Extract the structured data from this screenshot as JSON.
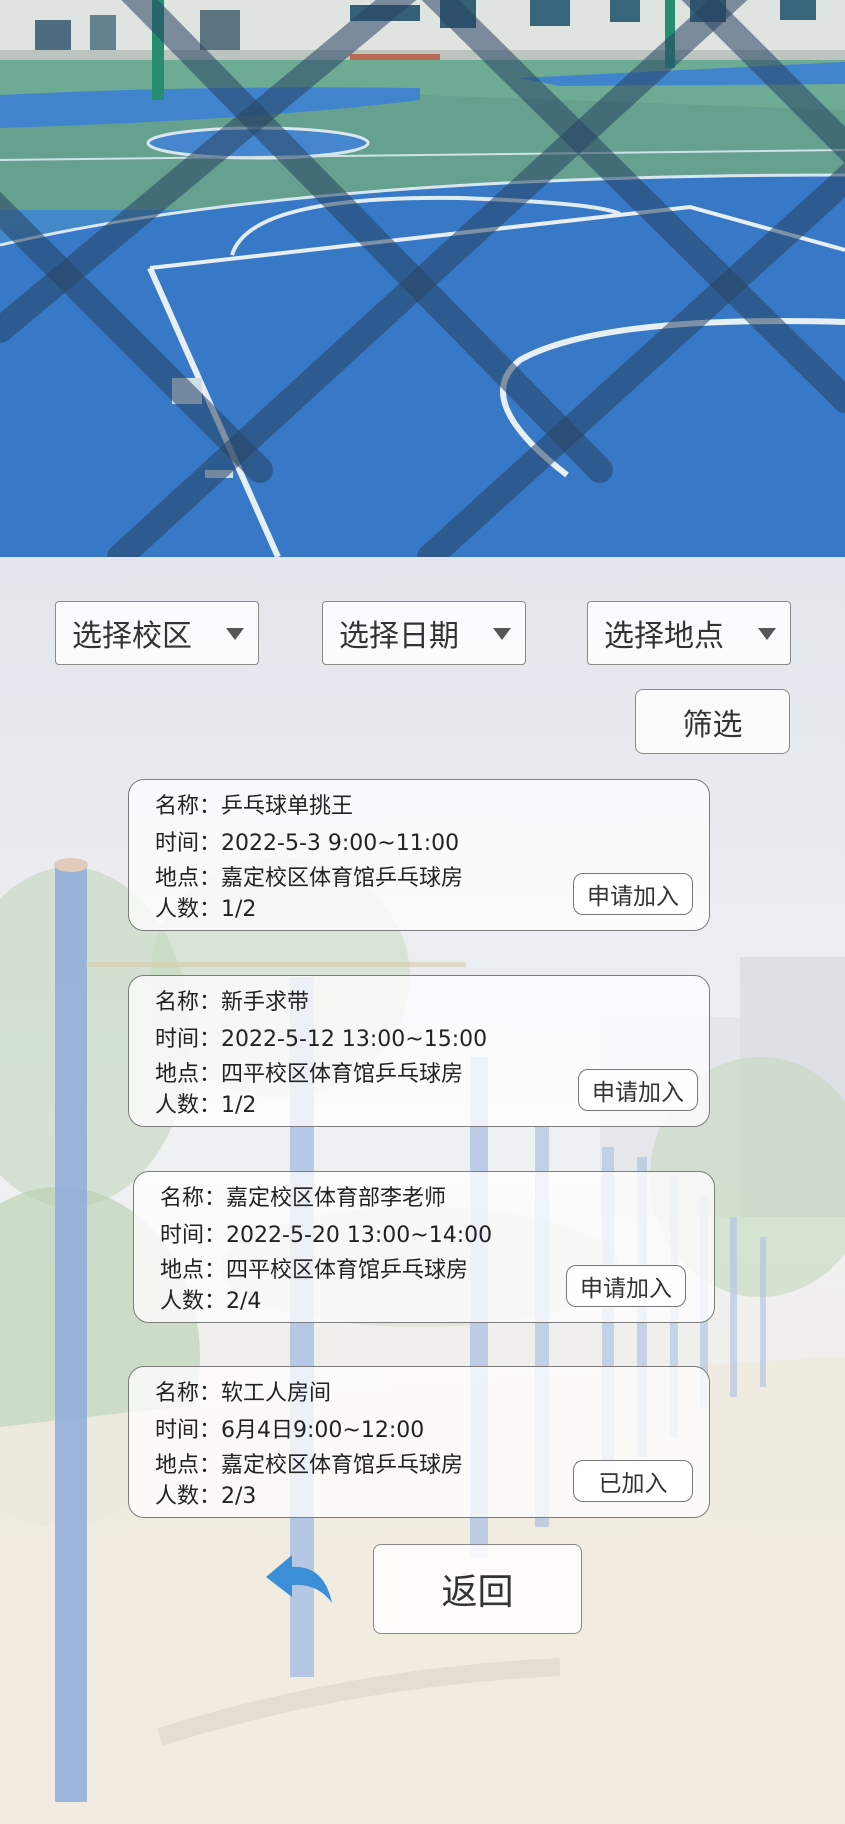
{
  "filters": {
    "campus_label": "选择校区",
    "date_label": "选择日期",
    "place_label": "选择地点",
    "filter_button": "筛选"
  },
  "rooms": [
    {
      "name_label": "名称：",
      "name": "乒乓球单挑王",
      "time_label": "时间：",
      "time": "2022-5-3 9:00~11:00",
      "place_label": "地点：",
      "place": "嘉定校区体育馆乒乓球房",
      "count_label": "人数：",
      "count": "1/2",
      "action": "申请加入"
    },
    {
      "name_label": "名称：",
      "name": "新手求带",
      "time_label": "时间：",
      "time": "2022-5-12 13:00~15:00",
      "place_label": "地点：",
      "place": "四平校区体育馆乒乓球房",
      "count_label": "人数：",
      "count": "1/2",
      "action": "申请加入"
    },
    {
      "name_label": "名称：",
      "name": "嘉定校区体育部李老师",
      "time_label": "时间：",
      "time": "2022-5-20 13:00~14:00",
      "place_label": "地点：",
      "place": "四平校区体育馆乒乓球房",
      "count_label": "人数：",
      "count": "2/4",
      "action": "申请加入"
    },
    {
      "name_label": "名称：",
      "name": "软工人房间",
      "time_label": "时间：",
      "time": "6月4日9:00~12:00",
      "place_label": "地点：",
      "place": "嘉定校区体育馆乒乓球房",
      "count_label": "人数：",
      "count": "2/3",
      "action": "已加入"
    }
  ],
  "back": {
    "label": "返回",
    "icon": "back-arrow-icon",
    "icon_color": "#3a8fd6"
  },
  "colors": {
    "court_blue": "#2f74c4",
    "court_green": "#5f9e8a",
    "border": "#8a8a8a"
  }
}
